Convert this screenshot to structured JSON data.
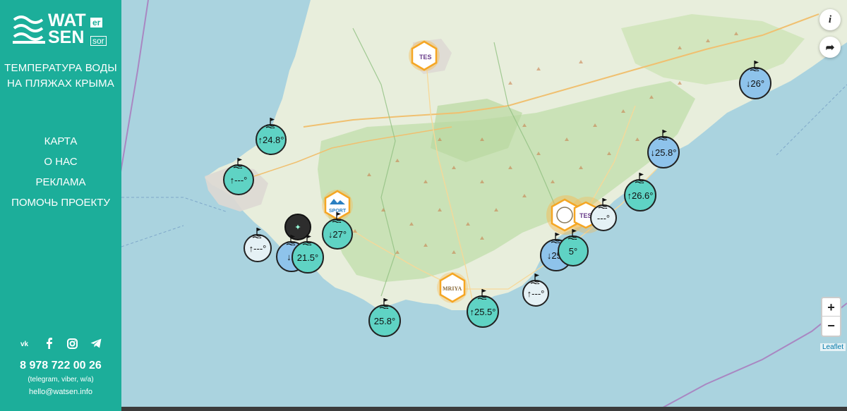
{
  "sidebar": {
    "logo": {
      "line1": "WAT",
      "line1_sup": "er",
      "line2": "SEN",
      "line2_sub": "sor"
    },
    "title_line1": "ТЕМПЕРАТУРА ВОДЫ",
    "title_line2": "НА ПЛЯЖАХ КРЫМА",
    "nav": [
      {
        "label": "КАРТА"
      },
      {
        "label": "О НАС"
      },
      {
        "label": "РЕКЛАМА"
      },
      {
        "label": "ПОМОЧЬ ПРОЕКТУ"
      }
    ],
    "social_icons": [
      "vk-icon",
      "facebook-icon",
      "instagram-icon",
      "telegram-icon"
    ],
    "phone": "8 978 722 00 26",
    "phone_note": "(telegram, viber, w/a)",
    "email": "hello@watsen.info"
  },
  "map": {
    "controls": {
      "info": "i",
      "share": "➦",
      "zoom_in": "+",
      "zoom_out": "−",
      "attribution": "Leaflet"
    },
    "markers": [
      {
        "label": "↑24.8°",
        "color": "green"
      },
      {
        "label": "↑---°",
        "color": "green"
      },
      {
        "label": "↑---°",
        "color": "white"
      },
      {
        "label": "↓2",
        "color": "blue"
      },
      {
        "label": "21.5°",
        "color": "green"
      },
      {
        "label": "↓27°",
        "color": "green"
      },
      {
        "label": "25.8°",
        "color": "green"
      },
      {
        "label": "↑25.5°",
        "color": "green"
      },
      {
        "label": "↑---°",
        "color": "white"
      },
      {
        "label": "↓25°",
        "color": "blue"
      },
      {
        "label": "5°",
        "color": "green"
      },
      {
        "label": "↑26.6°",
        "color": "green"
      },
      {
        "label": "↓25.8°",
        "color": "blue"
      },
      {
        "label": "---°",
        "color": "white"
      },
      {
        "label": "↓26°",
        "color": "blue"
      }
    ],
    "hotels": [
      "TES",
      "SPORT",
      "MRIYA",
      "TES"
    ],
    "colors": {
      "sea": "#aad3df",
      "land": "#e8eedc",
      "forest": "#b6d7a8",
      "accent": "#1cae9a"
    }
  }
}
